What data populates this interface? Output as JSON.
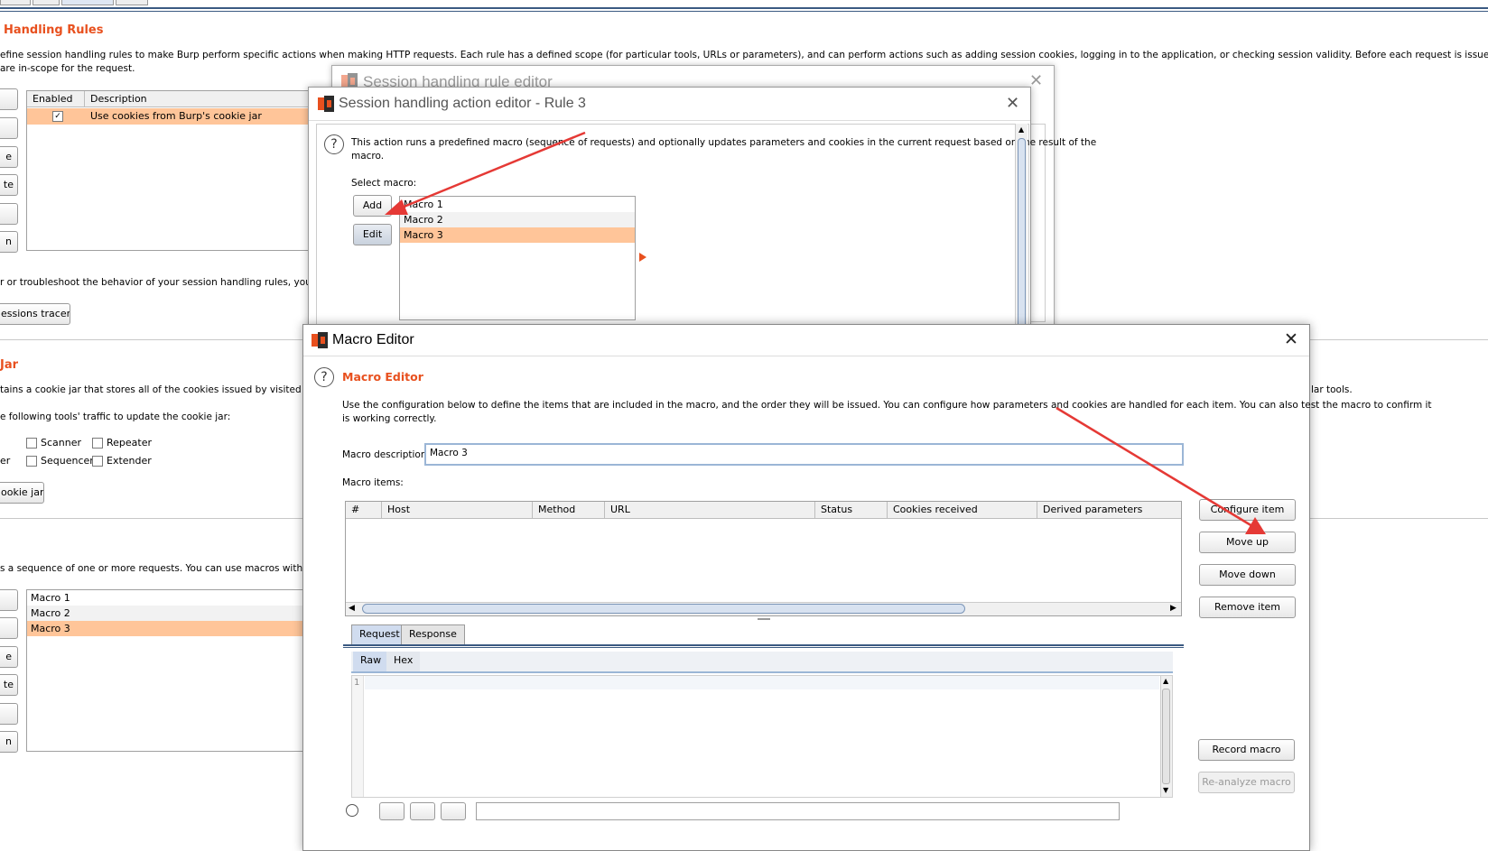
{
  "bg": {
    "section1_title": "Handling Rules",
    "section1_desc_l1": "efine session handling rules to make Burp perform specific actions when making HTTP requests. Each rule has a defined scope (for particular tools, URLs or parameters), and can perform actions such as adding session cookies, logging in to the application, or checking session validity. Before each request is issued, Burp applies in sequenc",
    "section1_desc_l2": "are in-scope for the request.",
    "rules_table": {
      "columns": [
        "Enabled",
        "Description"
      ],
      "rows": [
        {
          "enabled": "✓",
          "description": "Use cookies from Burp's cookie jar"
        }
      ]
    },
    "left_btn_frags": [
      "",
      "",
      "e",
      "te",
      "",
      "n"
    ],
    "tracer_text": "r or troubleshoot the behavior of your session handling rules, you can use t",
    "tracer_btn": "essions tracer",
    "section2_title": "Jar",
    "cookiejar_desc": "tains a cookie jar that stores all of the cookies issued by visited web sites",
    "cookiejar_desc_right": "lar tools.",
    "cookiejar_tools_text": "e following tools' traffic to update the cookie jar:",
    "tools": [
      "Scanner",
      "Repeater",
      "Sequencer",
      "Extender"
    ],
    "tool_row2_frag": "er",
    "cookiejar_btn": "ookie jar",
    "macros_desc": "s a sequence of one or more requests. You can use macros within sessi",
    "macros": [
      "Macro 1",
      "Macro 2",
      "Macro 3"
    ],
    "left_btn_frags2": [
      "",
      "",
      "e",
      "te",
      "",
      "n"
    ]
  },
  "rule_editor": {
    "title": "Session handling rule editor"
  },
  "action_editor": {
    "title": "Session handling action editor - Rule 3",
    "help_text_l1": "This action runs a predefined macro (sequence of requests) and optionally updates parameters and cookies in the current request based on the result of the",
    "help_text_l2": "macro.",
    "select_label": "Select macro:",
    "add_btn": "Add",
    "edit_btn": "Edit",
    "macros": [
      "Macro 1",
      "Macro 2",
      "Macro 3"
    ]
  },
  "macro_editor": {
    "window_title": "Macro Editor",
    "heading": "Macro Editor",
    "desc_l1": "Use the configuration below to define the items that are included in the macro, and the order they will be issued. You can configure how parameters and cookies are handled for each item. You can also test the macro to confirm it",
    "desc_l2": "is working correctly.",
    "desc_label": "Macro description:",
    "desc_value": "Macro 3",
    "items_label": "Macro items:",
    "columns": [
      "#",
      "Host",
      "Method",
      "URL",
      "Status",
      "Cookies received",
      "Derived parameters"
    ],
    "buttons": {
      "configure": "Configure item",
      "move_up": "Move up",
      "move_down": "Move down",
      "remove": "Remove item",
      "record": "Record macro",
      "reanalyze": "Re-analyze macro"
    },
    "tabs": [
      "Request",
      "Response"
    ],
    "subtabs": [
      "Raw",
      "Hex"
    ],
    "line_number": "1"
  },
  "colors": {
    "accent": "#e8501e",
    "selection": "#ffc599",
    "arrow": "#e53935"
  }
}
